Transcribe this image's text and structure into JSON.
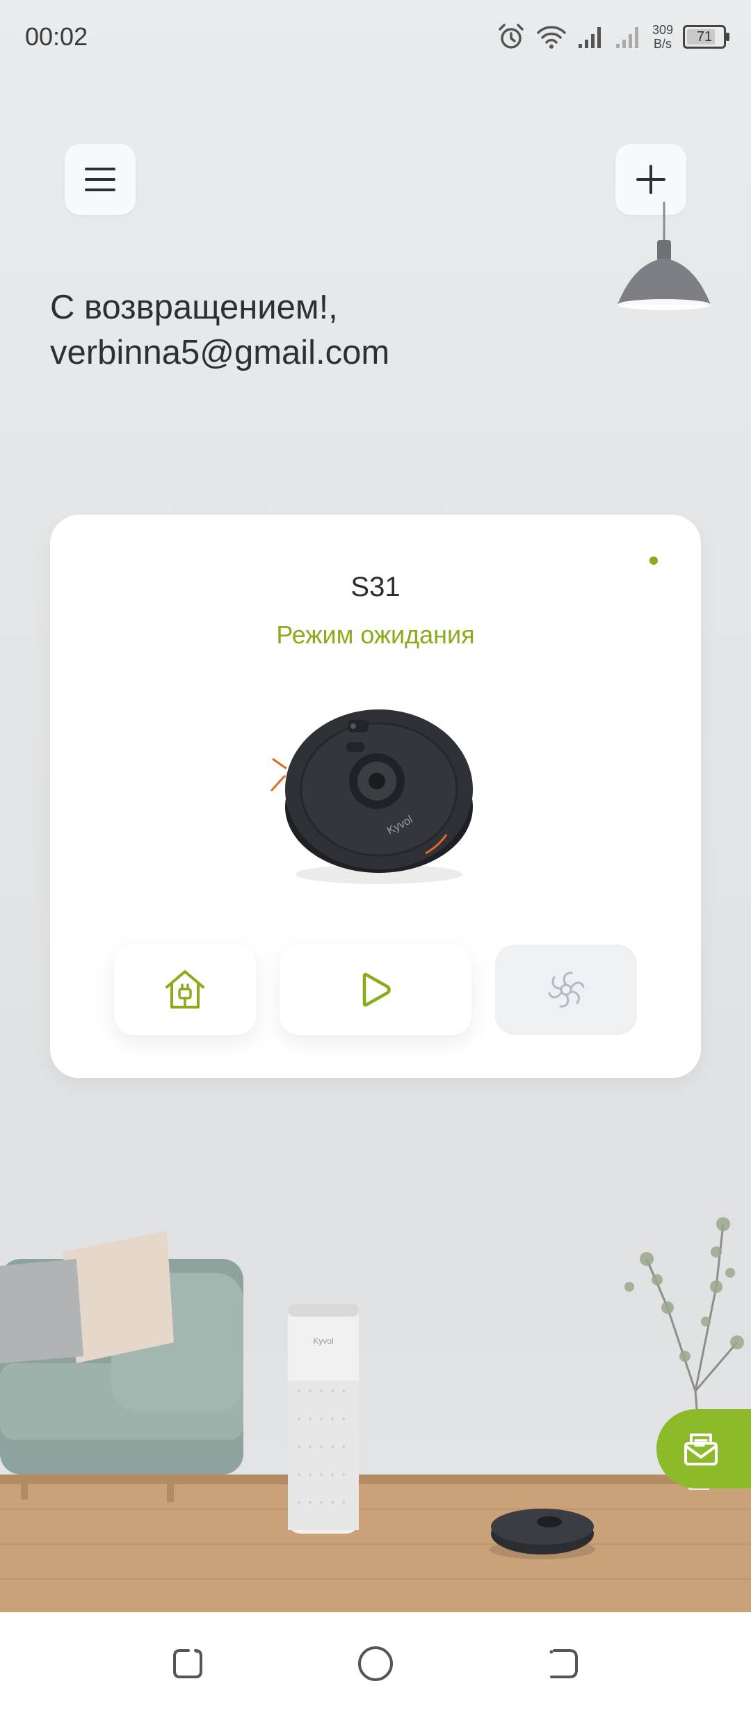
{
  "status_bar": {
    "time": "00:02",
    "net_speed_value": "309",
    "net_speed_unit": "B/s",
    "battery": "71",
    "icons": [
      "alarm-icon",
      "wifi-icon",
      "signal-icon",
      "signal-icon"
    ]
  },
  "header": {
    "menu_icon": "hamburger-menu-icon",
    "add_icon": "plus-icon"
  },
  "greeting": {
    "line1": "С возвращением!,",
    "email": "verbinna5@gmail.com"
  },
  "device": {
    "name": "S31",
    "status": "Режим ожидания",
    "online": true,
    "image_label": "Kyvol",
    "actions": [
      {
        "icon": "dock-charge-icon",
        "enabled": true
      },
      {
        "icon": "play-icon",
        "enabled": true
      },
      {
        "icon": "suction-fan-icon",
        "enabled": false
      }
    ]
  },
  "scene": {
    "purifier_label": "Kyvol"
  },
  "feedback": {
    "icon": "feedback-mail-icon"
  },
  "colors": {
    "accent": "#8aab1c",
    "accent_button": "#8dba2a",
    "text_dark": "#2d3033",
    "card": "#ffffff"
  }
}
